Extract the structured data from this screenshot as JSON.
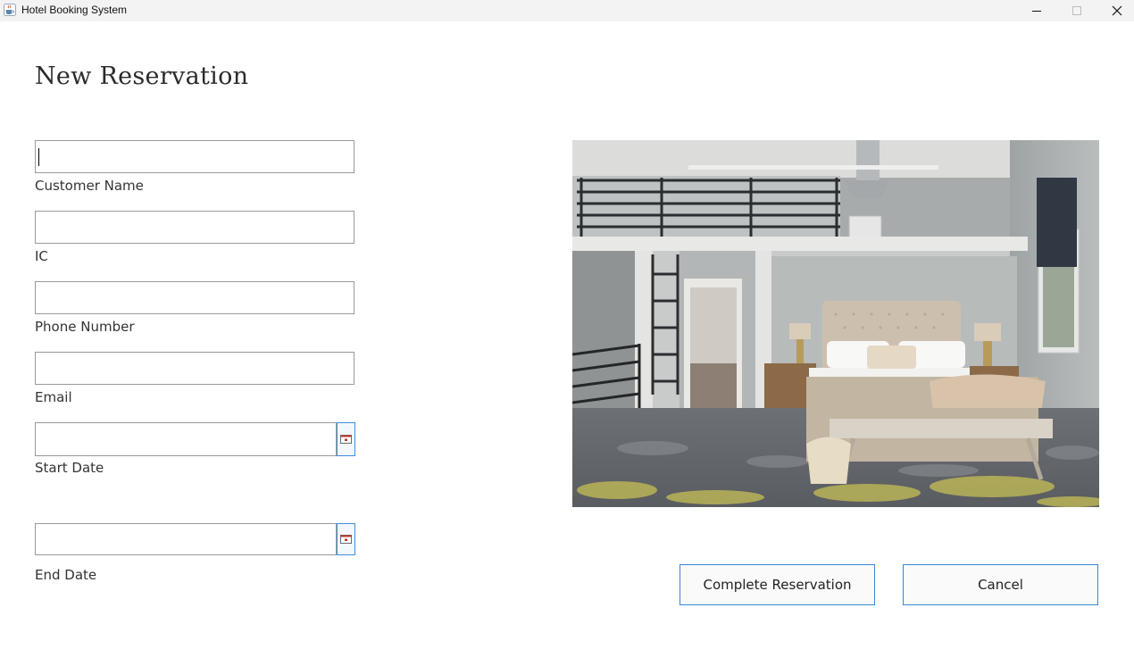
{
  "window": {
    "title": "Hotel Booking System",
    "app_icon": "java-cup-icon"
  },
  "form": {
    "heading": "New Reservation",
    "fields": [
      {
        "label": "Customer Name",
        "value": ""
      },
      {
        "label": "IC",
        "value": ""
      },
      {
        "label": "Phone Number",
        "value": ""
      },
      {
        "label": "Email",
        "value": ""
      },
      {
        "label": "Start Date",
        "value": ""
      },
      {
        "label": "End Date",
        "value": ""
      }
    ],
    "calendar_icon": "calendar-icon"
  },
  "image": {
    "subject": "hotel-room-photo"
  },
  "actions": {
    "complete_label": "Complete Reservation",
    "cancel_label": "Cancel"
  },
  "colors": {
    "accent": "#3a86d6",
    "title_bar": "#f3f3f3"
  }
}
